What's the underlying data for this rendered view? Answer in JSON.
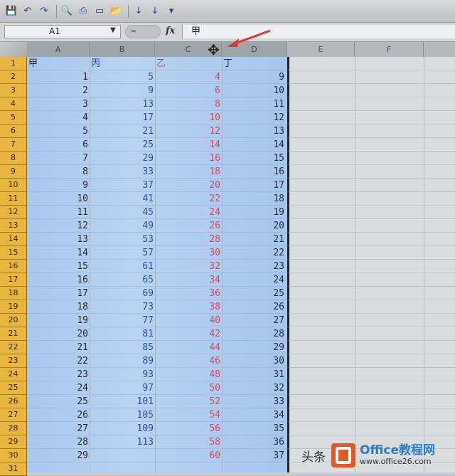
{
  "toolbar": {
    "icons": [
      "save-icon",
      "undo-icon",
      "redo-icon",
      "print-preview-icon",
      "print-icon",
      "new-doc-icon",
      "open-icon",
      "sort-asc-icon",
      "sort-desc-icon",
      "customize-icon"
    ]
  },
  "formula_bar": {
    "name_box": "A1",
    "fx_label": "fx",
    "formula": "甲",
    "mini_placeholder": "="
  },
  "columns": [
    "A",
    "B",
    "C",
    "D",
    "E",
    "F"
  ],
  "rows": [
    "1",
    "2",
    "3",
    "4",
    "5",
    "6",
    "7",
    "8",
    "9",
    "10",
    "11",
    "12",
    "13",
    "14",
    "15",
    "16",
    "17",
    "18",
    "19",
    "20",
    "21",
    "22",
    "23",
    "24",
    "25",
    "26",
    "27",
    "28",
    "29",
    "30",
    "31"
  ],
  "headers": {
    "A": "甲",
    "B": "丙",
    "C": "乙",
    "D": "丁"
  },
  "data": {
    "A": [
      "1",
      "2",
      "3",
      "4",
      "5",
      "6",
      "7",
      "8",
      "9",
      "10",
      "11",
      "12",
      "13",
      "14",
      "15",
      "16",
      "17",
      "18",
      "19",
      "20",
      "21",
      "22",
      "23",
      "24",
      "25",
      "26",
      "27",
      "28",
      "29"
    ],
    "B": [
      "5",
      "9",
      "13",
      "17",
      "21",
      "25",
      "29",
      "33",
      "37",
      "41",
      "45",
      "49",
      "53",
      "57",
      "61",
      "65",
      "69",
      "73",
      "77",
      "81",
      "85",
      "89",
      "93",
      "97",
      "101",
      "105",
      "109",
      "113"
    ],
    "C": [
      "4",
      "6",
      "8",
      "10",
      "12",
      "14",
      "16",
      "18",
      "20",
      "22",
      "24",
      "26",
      "28",
      "30",
      "32",
      "34",
      "36",
      "38",
      "40",
      "42",
      "44",
      "46",
      "48",
      "50",
      "52",
      "54",
      "56",
      "58",
      "60"
    ],
    "D": [
      "9",
      "10",
      "11",
      "12",
      "13",
      "14",
      "15",
      "16",
      "17",
      "18",
      "19",
      "20",
      "21",
      "22",
      "23",
      "24",
      "25",
      "26",
      "27",
      "28",
      "29",
      "30",
      "31",
      "32",
      "33",
      "34",
      "35",
      "36",
      "37"
    ]
  },
  "colors": {
    "selection": "#a9c8ef",
    "row_header": "#e8b63e",
    "col_c_text": "#d8465a",
    "annotation_arrow": "#e3343c"
  },
  "watermark": {
    "prefix": "头条",
    "title": "Office教程网",
    "site": "www.office26.com"
  }
}
